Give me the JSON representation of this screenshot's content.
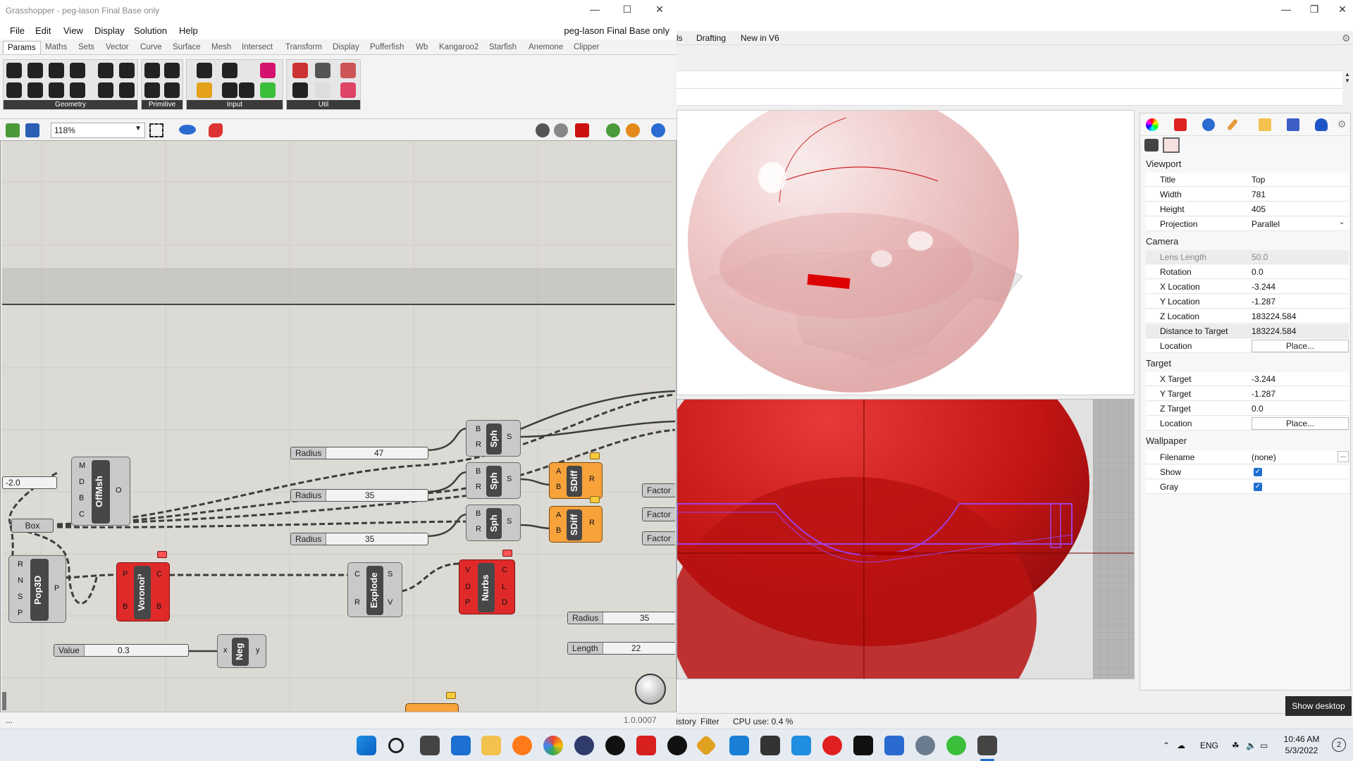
{
  "rhino": {
    "tabs": [
      "ls",
      "Drafting",
      "New in V6"
    ],
    "properties": {
      "sections": {
        "viewport": "Viewport",
        "camera": "Camera",
        "target": "Target",
        "wallpaper": "Wallpaper"
      },
      "viewport": {
        "title_label": "Title",
        "title": "Top",
        "width_label": "Width",
        "width": "781",
        "height_label": "Height",
        "height": "405",
        "projection_label": "Projection",
        "projection": "Parallel"
      },
      "camera": {
        "lens_label": "Lens Length",
        "lens": "50.0",
        "rotation_label": "Rotation",
        "rotation": "0.0",
        "xloc_label": "X Location",
        "xloc": "-3.244",
        "yloc_label": "Y Location",
        "yloc": "-1.287",
        "zloc_label": "Z Location",
        "zloc": "183224.584",
        "dist_label": "Distance to Target",
        "dist": "183224.584",
        "location_label": "Location",
        "place": "Place..."
      },
      "target": {
        "x_label": "X Target",
        "x": "-3.244",
        "y_label": "Y Target",
        "y": "-1.287",
        "z_label": "Z Target",
        "z": "0.0",
        "location_label": "Location",
        "place": "Place..."
      },
      "wallpaper": {
        "filename_label": "Filename",
        "filename": "(none)",
        "browse": "...",
        "show_label": "Show",
        "gray_label": "Gray",
        "show": true,
        "gray": true
      }
    },
    "status": {
      "history": "History",
      "filter": "Filter",
      "cpu": "CPU use: 0.4 %"
    },
    "show_desktop": "Show desktop"
  },
  "grasshopper": {
    "title": "Grasshopper - peg-lason Final Base only",
    "doc_name": "peg-lason Final Base only",
    "menu": [
      "File",
      "Edit",
      "View",
      "Display",
      "Solution",
      "Help"
    ],
    "tabs": [
      "Params",
      "Maths",
      "Sets",
      "Vector",
      "Curve",
      "Surface",
      "Mesh",
      "Intersect",
      "Transform",
      "Display",
      "Pufferfish",
      "Wb",
      "Kangaroo2",
      "Starfish",
      "Anemone",
      "Clipper"
    ],
    "active_tab": "Params",
    "ribbon_groups": [
      "Geometry",
      "Primitive",
      "Input",
      "Util"
    ],
    "zoom": "118%",
    "status_left": "...",
    "version": "1.0.0007",
    "components": {
      "sph": "Sph",
      "sdiff": "SDiff",
      "offmsh": "OffMsh",
      "pop3d": "Pop3D",
      "voronoi": "Voronoi³",
      "explode": "Explode",
      "nurbs": "Nurbs",
      "neg": "Neg",
      "box": "Box",
      "factor": "Factor"
    },
    "sliders": [
      {
        "label": "Radius",
        "value": "47"
      },
      {
        "label": "Radius",
        "value": "35"
      },
      {
        "label": "Radius",
        "value": "35"
      },
      {
        "label": "Value",
        "value": "0.3"
      },
      {
        "label": "Radius",
        "value": "35"
      },
      {
        "label": "Length",
        "value": "22"
      }
    ],
    "partial_value": "-2.0"
  },
  "taskbar": {
    "lang": "ENG",
    "time": "10:46 AM",
    "date": "5/3/2022",
    "notif": "2"
  }
}
